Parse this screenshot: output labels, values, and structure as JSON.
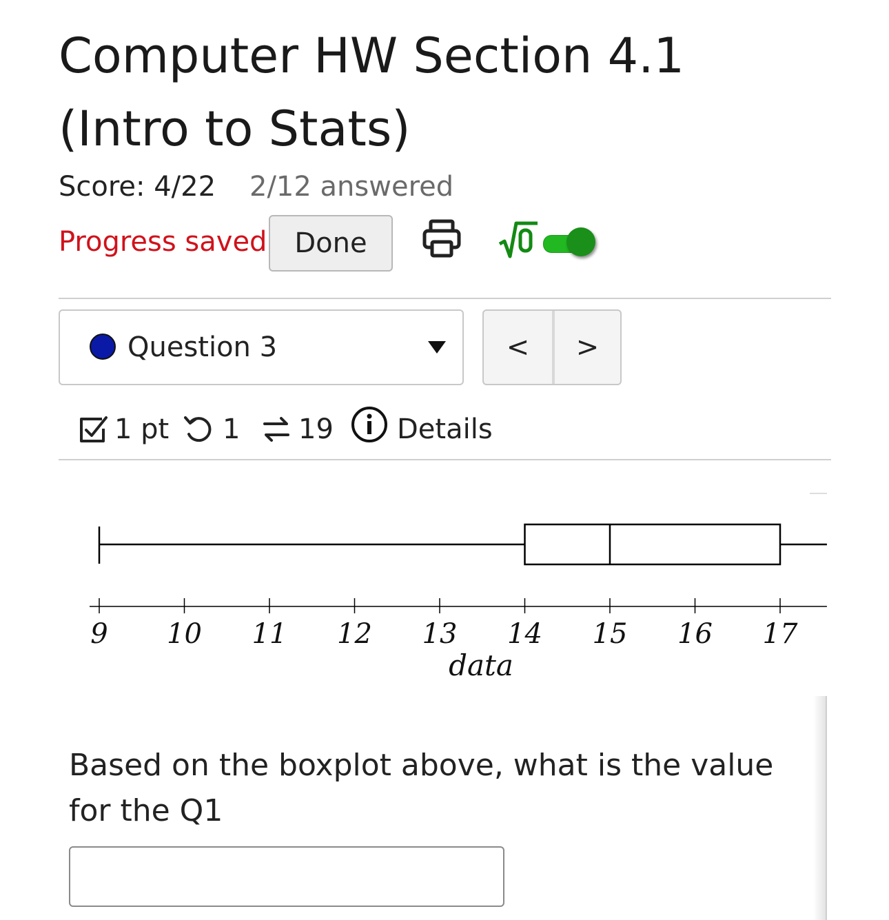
{
  "header": {
    "title": "Computer HW Section 4.1 (Intro to Stats)",
    "score": "Score: 4/22",
    "answered": "2/12 answered",
    "progress_status": "Progress saved",
    "done_label": "Done",
    "toggle_on": true
  },
  "question_nav": {
    "selected": "Question 3",
    "prev_label": "<",
    "next_label": ">"
  },
  "meta": {
    "points": "1 pt",
    "retries": "1",
    "attempts": "19",
    "details_label": "Details"
  },
  "chart_data": {
    "type": "boxplot",
    "xlabel": "data",
    "x_ticks": [
      9,
      10,
      11,
      12,
      13,
      14,
      15,
      16,
      17
    ],
    "xlim": [
      9,
      17.55
    ],
    "box": {
      "min": 9,
      "q1": 14,
      "median": 15,
      "q3": 17,
      "max_visible": 17.55
    }
  },
  "question": {
    "text": "Based on the boxplot above, what is the value for the Q1",
    "answer_value": ""
  },
  "colors": {
    "accent_red": "#d0121b",
    "toggle_green": "#22b822",
    "question_dot": "#0a1aa6"
  }
}
